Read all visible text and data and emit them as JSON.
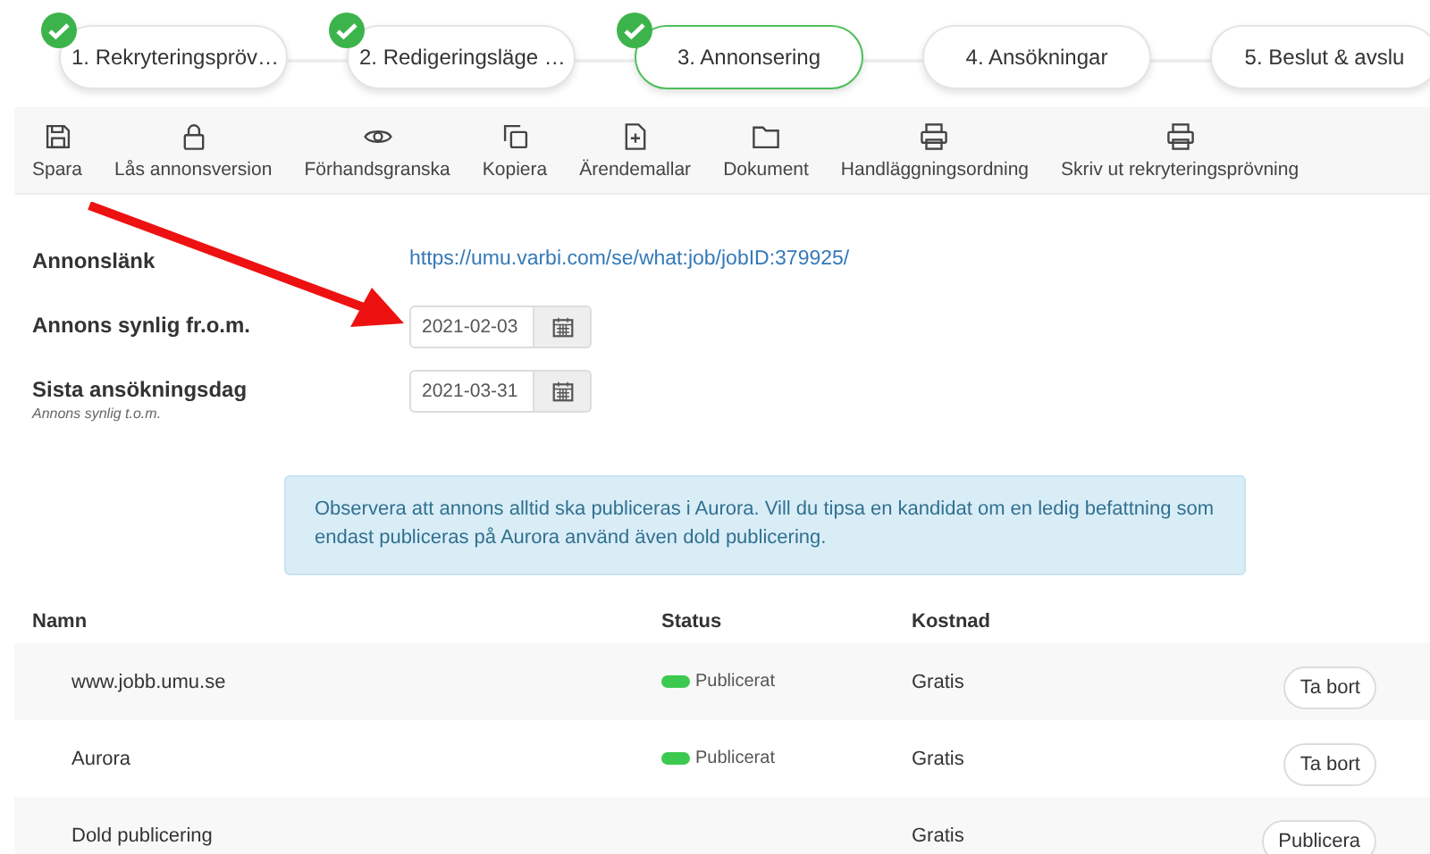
{
  "steps": [
    {
      "label": "1. Rekryteringspröv…",
      "done": true,
      "selected": false
    },
    {
      "label": "2. Redigeringsläge …",
      "done": true,
      "selected": false
    },
    {
      "label": "3. Annonsering",
      "done": true,
      "selected": true
    },
    {
      "label": "4. Ansökningar",
      "done": false,
      "selected": false
    },
    {
      "label": "5. Beslut & avslu",
      "done": false,
      "selected": false
    }
  ],
  "toolbar": [
    {
      "label": "Spara",
      "kind": "save"
    },
    {
      "label": "Lås annonsversion",
      "kind": "lock"
    },
    {
      "label": "Förhandsgranska",
      "kind": "eye"
    },
    {
      "label": "Kopiera",
      "kind": "copy"
    },
    {
      "label": "Ärendemallar",
      "kind": "file-plus"
    },
    {
      "label": "Dokument",
      "kind": "folder"
    },
    {
      "label": "Handläggningsordning",
      "kind": "print"
    },
    {
      "label": "Skriv ut rekryteringsprövning",
      "kind": "print"
    }
  ],
  "form": {
    "link_label": "Annonslänk",
    "link": "https://umu.varbi.com/se/what:job/jobID:379925/",
    "fields": [
      {
        "label": "Annons synlig fr.o.m.",
        "value": "2021-02-03"
      },
      {
        "label": "Sista ansökningsdag",
        "hint": "Annons synlig t.o.m.",
        "value": "2021-03-31"
      }
    ]
  },
  "notice": "Observera att annons alltid ska publiceras i Aurora. Vill du tipsa en kandidat om en ledig befattning som endast publiceras på Aurora använd även dold publicering.",
  "table": {
    "columns": [
      "Namn",
      "Status",
      "Kostnad"
    ],
    "rows": [
      {
        "name": "www.jobb.umu.se",
        "status": "Publicerat",
        "published": true,
        "cost": "Gratis",
        "action": "Ta bort"
      },
      {
        "name": "Aurora",
        "status": "Publicerat",
        "published": true,
        "cost": "Gratis",
        "action": "Ta bort"
      },
      {
        "name": "Dold publicering",
        "published": false,
        "cost": "Gratis",
        "action": "Publicera"
      }
    ]
  },
  "annotation_arrow": true
}
